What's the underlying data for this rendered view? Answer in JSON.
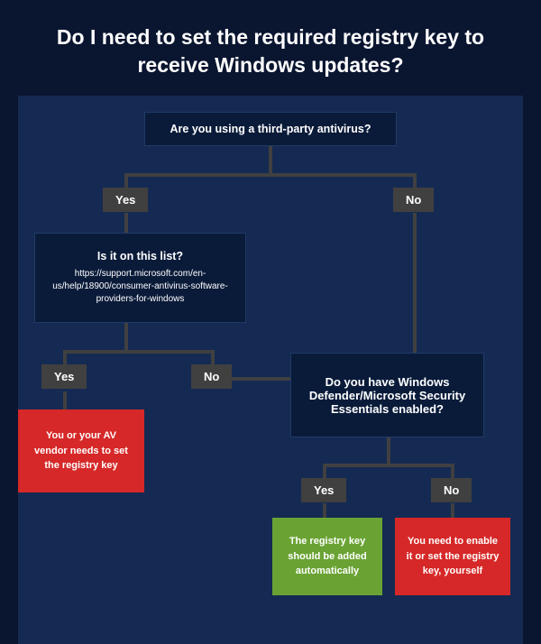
{
  "title": "Do I need to set the required registry key to receive Windows updates?",
  "q1": "Are you using a third-party antivirus?",
  "q2": {
    "main": "Is it on this list?",
    "sub": "https://support.microsoft.com/en-us/help/18900/consumer-antivirus-software-providers-for-windows"
  },
  "q3": "Do you have Windows Defender/Microsoft Security Essentials enabled?",
  "yes": "Yes",
  "no": "No",
  "out1": "You or your AV vendor needs to set the registry key",
  "out2": "The registry key should be added automatically",
  "out3": "You need to enable it or set the registry key, yourself"
}
